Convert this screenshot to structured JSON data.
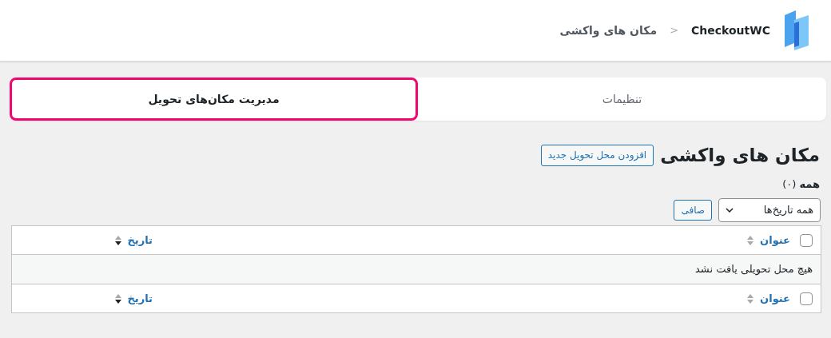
{
  "header": {
    "brand": "CheckoutWC",
    "separator": "<",
    "page": "مکان های واکشی"
  },
  "tabs": [
    {
      "label": "تنظیمات",
      "selected": false
    },
    {
      "label": "مدیریت مکان‌های تحویل",
      "selected": true
    }
  ],
  "title": "مکان های واکشی",
  "add_button": "افزودن محل تحویل جدید",
  "filter_count": {
    "label": "همه",
    "count": "(۰)"
  },
  "date_filter": {
    "value": "همه تاریخ‌ها"
  },
  "filter_button": "صافی",
  "table": {
    "columns": [
      "عنوان",
      "تاریخ"
    ],
    "footer_columns": [
      "عنوان",
      "تاریخ"
    ],
    "header_checked": false,
    "footer_checked": false,
    "empty_message": "هیچ محل تحویلی یافت نشد"
  }
}
